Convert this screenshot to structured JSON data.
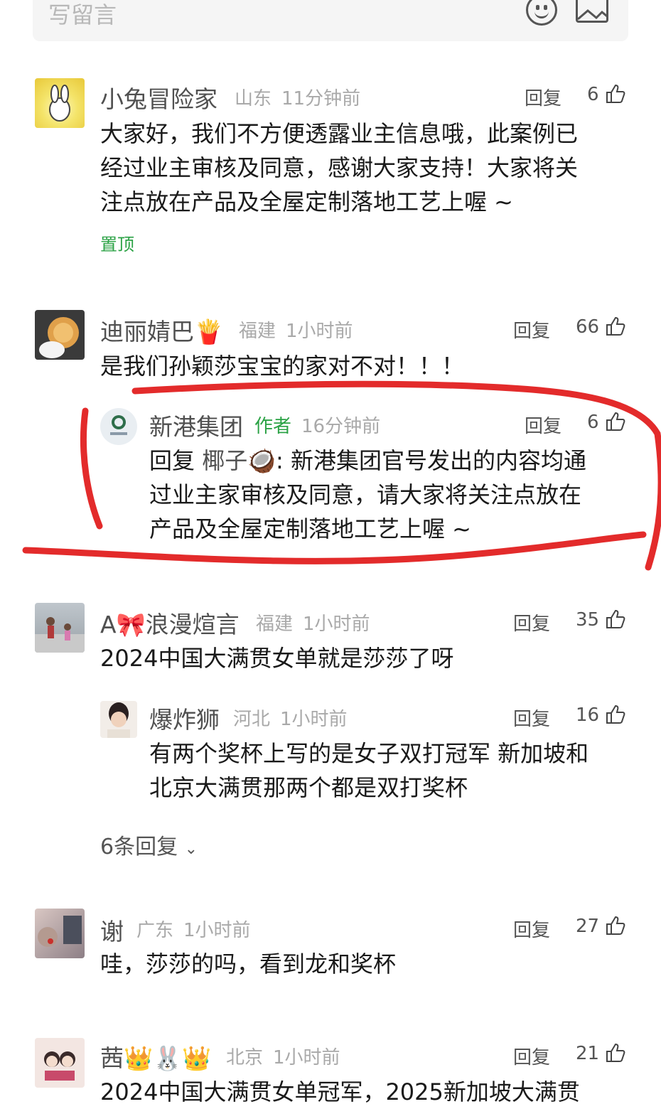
{
  "input": {
    "placeholder": "写留言"
  },
  "comments": [
    {
      "name": "小兔冒险家",
      "location": "山东",
      "time": "11分钟前",
      "reply_label": "回复",
      "likes": "6",
      "text_lines": [
        "大家好，我们不方便透露业主信息哦，此案例已",
        "经过业主审核及同意，感谢大家支持！大家将关",
        "注点放在产品及全屋定制落地工艺上喔 ~"
      ],
      "pin_label": "置顶"
    },
    {
      "name": "迪丽婧巴",
      "emoji": "🍟",
      "location": "福建",
      "time": "1小时前",
      "reply_label": "回复",
      "likes": "66",
      "text_lines": [
        "是我们孙颖莎宝宝的家对不对！！！"
      ],
      "sub": {
        "name": "新港集团",
        "author_tag": "作者",
        "time": "16分钟前",
        "reply_label": "回复",
        "likes": "6",
        "reply_prefix": "回复",
        "reply_to": "椰子🥥",
        "text_lines": [
          ": 新港集团官号发出的内容均通",
          "过业主家审核及同意，请大家将关注点放在",
          "产品及全屋定制落地工艺上喔 ~"
        ]
      }
    },
    {
      "name_prefix": "A",
      "name_emoji": "🎀",
      "name": "浪漫煊言",
      "location": "福建",
      "time": "1小时前",
      "reply_label": "回复",
      "likes": "35",
      "text_lines": [
        "2024中国大满贯女单就是莎莎了呀"
      ],
      "sub": {
        "name": "爆炸狮",
        "location": "河北",
        "time": "1小时前",
        "reply_label": "回复",
        "likes": "16",
        "text_lines": [
          "有两个奖杯上写的是女子双打冠军 新加坡和",
          "北京大满贯那两个都是双打奖杯"
        ]
      },
      "more_replies": "6条回复"
    },
    {
      "name": "谢",
      "location": "广东",
      "time": "1小时前",
      "reply_label": "回复",
      "likes": "27",
      "text_lines": [
        "哇，莎莎的吗，看到龙和奖杯"
      ]
    },
    {
      "name": "茜",
      "emojis": "👑🐰👑",
      "location": "北京",
      "time": "1小时前",
      "reply_label": "回复",
      "likes": "21",
      "text_lines": [
        "2024中国大满贯女单冠军，2025新加坡大满贯"
      ]
    }
  ]
}
